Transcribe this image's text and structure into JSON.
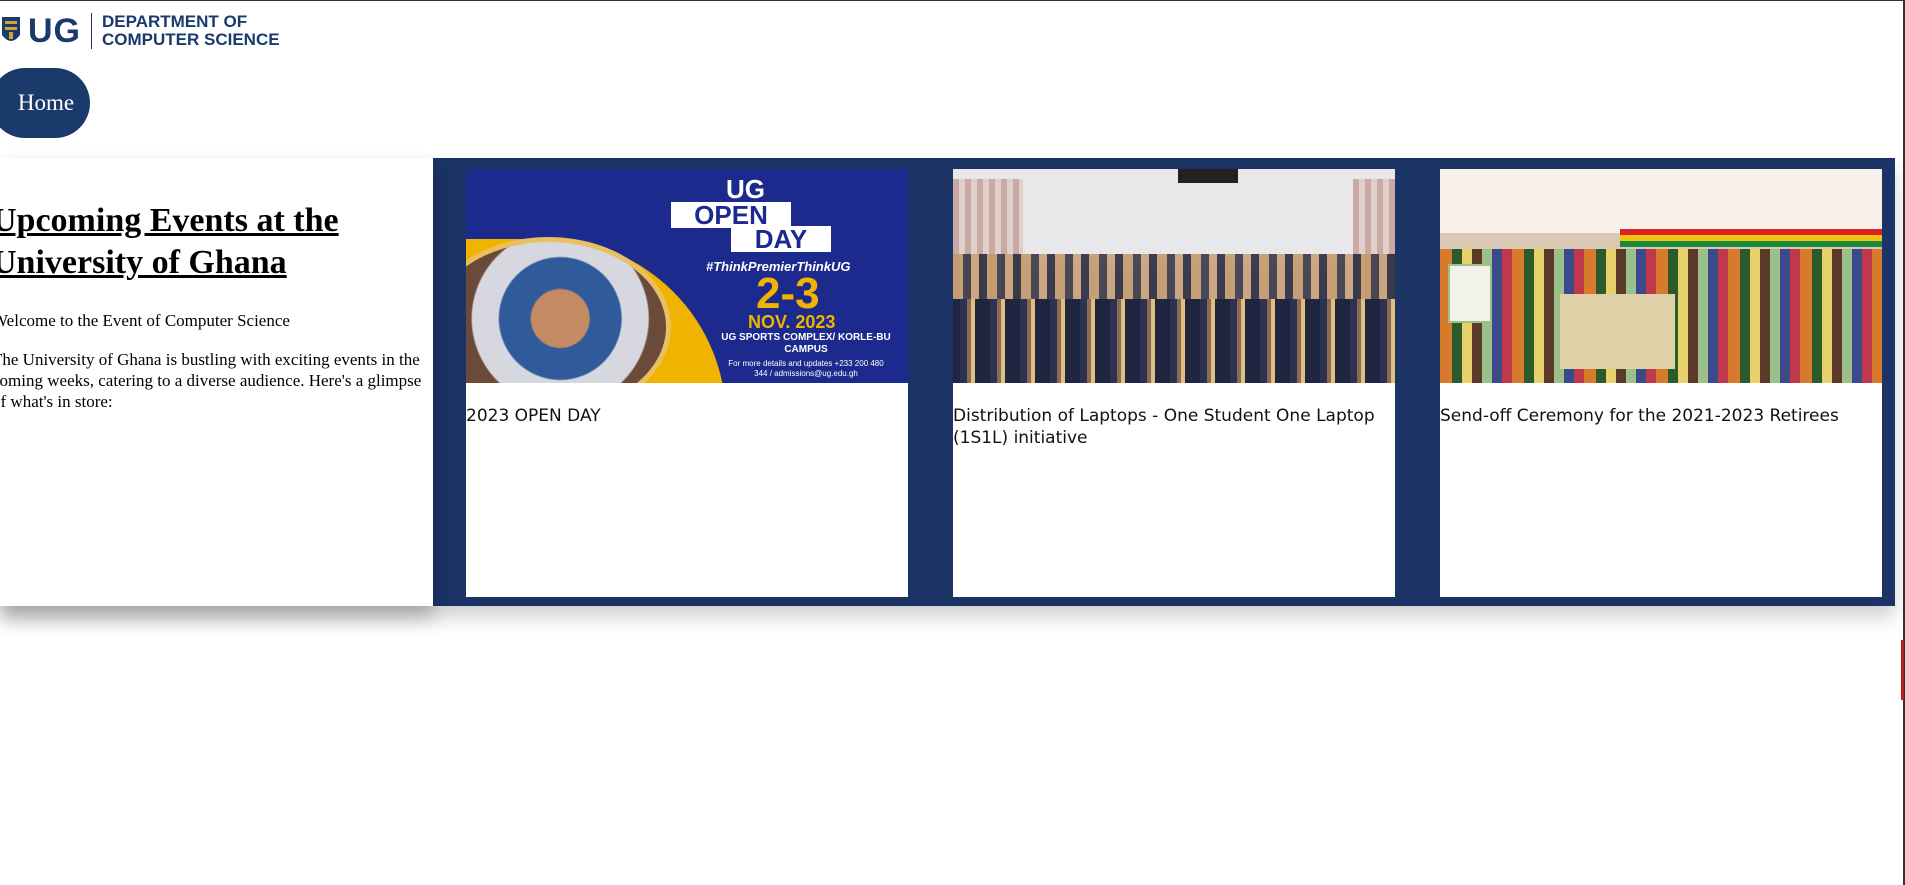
{
  "header": {
    "logo_ug": "UG",
    "dept_line1": "DEPARTMENT OF",
    "dept_line2": "COMPUTER SCIENCE"
  },
  "nav": {
    "home_label": "Home"
  },
  "intro": {
    "title_line1": "Upcoming Events at the",
    "title_line2": "University of Ghana",
    "welcome": "Welcome to the Event of Computer Science",
    "description": "The University of Ghana is bustling with exciting events in the coming weeks, catering to a diverse audience. Here's a glimpse of what's in store:"
  },
  "events": [
    {
      "caption": "2023 OPEN DAY",
      "poster": {
        "ug": "UG",
        "open": "OPEN",
        "day": "DAY",
        "hashtag": "#ThinkPremierThinkUG",
        "date": "2-3",
        "month": "NOV. 2023",
        "venue": "UG SPORTS COMPLEX/ KORLE-BU CAMPUS",
        "contact": "For more details and updates +233 200 480 344 / admissions@ug.edu.gh"
      }
    },
    {
      "caption": "Distribution of Laptops - One Student One Laptop (1S1L) initiative"
    },
    {
      "caption": "Send-off Ceremony for the 2021-2023 Retirees"
    }
  ],
  "colors": {
    "brand_navy": "#1a3a6b",
    "band_navy": "#1b3365",
    "poster_yellow": "#f0b400"
  }
}
